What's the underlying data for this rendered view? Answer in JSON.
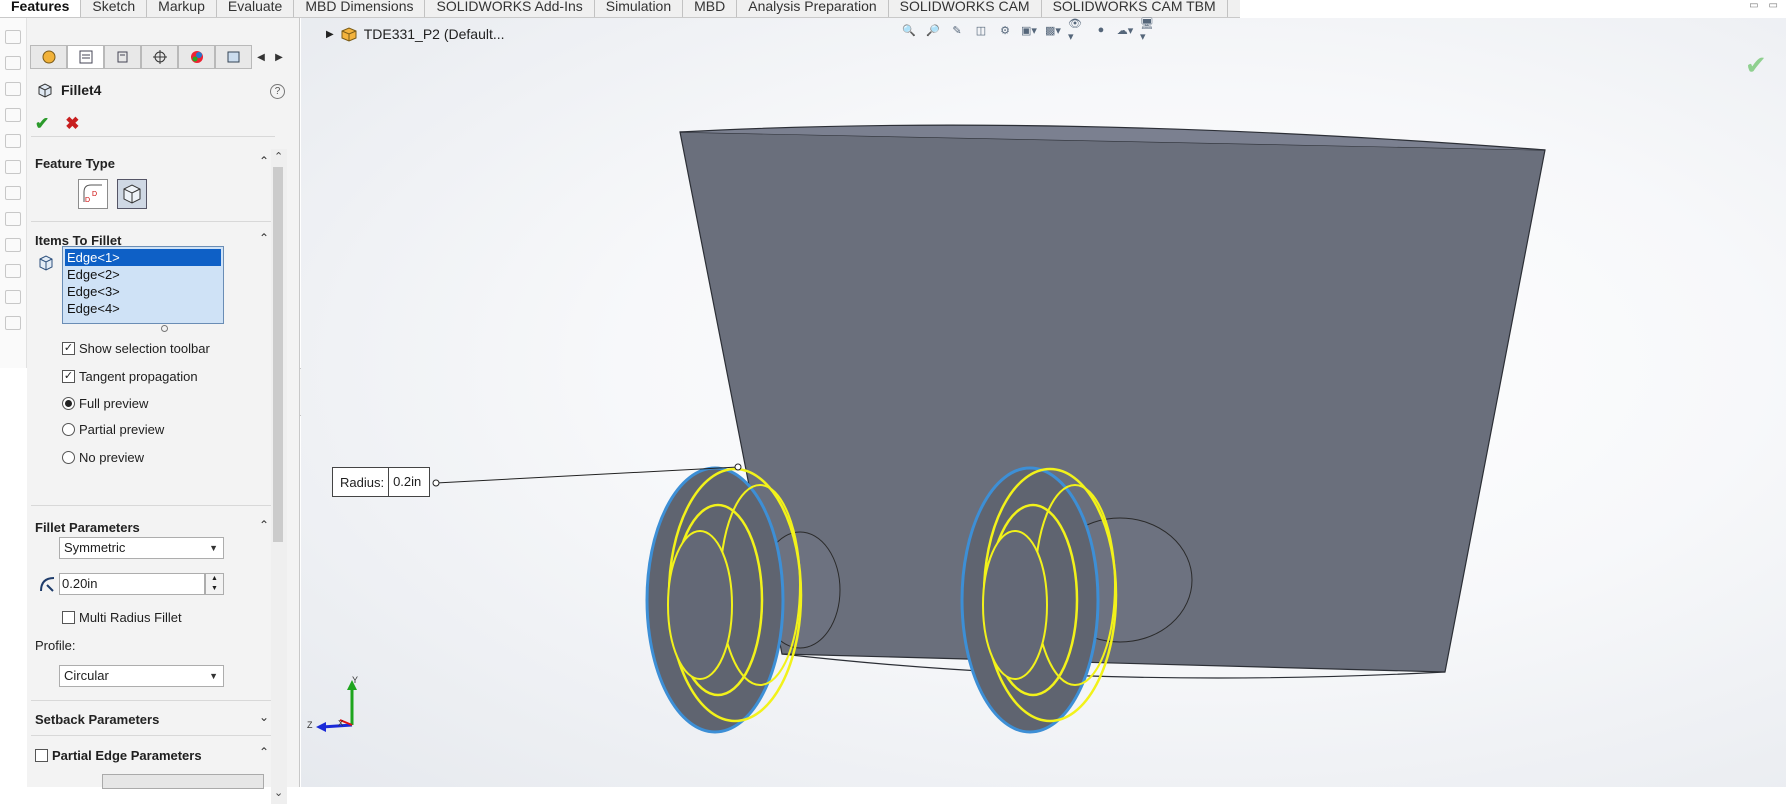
{
  "tabs": [
    "Features",
    "Sketch",
    "Markup",
    "Evaluate",
    "MBD Dimensions",
    "SOLIDWORKS Add-Ins",
    "Simulation",
    "MBD",
    "Analysis Preparation",
    "SOLIDWORKS CAM",
    "SOLIDWORKS CAM TBM"
  ],
  "active_tab": "Features",
  "feature": {
    "name": "Fillet4",
    "help": "?",
    "ok_icon": "checkmark-icon",
    "cancel_icon": "x-icon"
  },
  "sections": {
    "feature_type": "Feature Type",
    "items_to_fillet": "Items To Fillet",
    "fillet_parameters": "Fillet Parameters",
    "setback_parameters": "Setback Parameters",
    "partial_edge_parameters": "Partial Edge Parameters"
  },
  "edges": [
    "Edge<1>",
    "Edge<2>",
    "Edge<3>",
    "Edge<4>"
  ],
  "options": {
    "show_selection_toolbar": "Show selection toolbar",
    "tangent_propagation": "Tangent propagation",
    "full_preview": "Full preview",
    "partial_preview": "Partial preview",
    "no_preview": "No preview"
  },
  "params": {
    "symmetric": "Symmetric",
    "radius_value": "0.20in",
    "multi_radius": "Multi Radius Fillet",
    "profile_label": "Profile:",
    "profile_value": "Circular"
  },
  "viewport": {
    "breadcrumb": "TDE331_P2  (Default...",
    "radius_label": "Radius:",
    "radius_value": "0.2in",
    "axis_y": "Y",
    "axis_z": "Z",
    "axis_x": "X"
  },
  "colors": {
    "model": "#6a6f7c",
    "highlight": "#f2f21a",
    "edge_select": "#3d8fd6",
    "selection": "#0e60c6"
  }
}
